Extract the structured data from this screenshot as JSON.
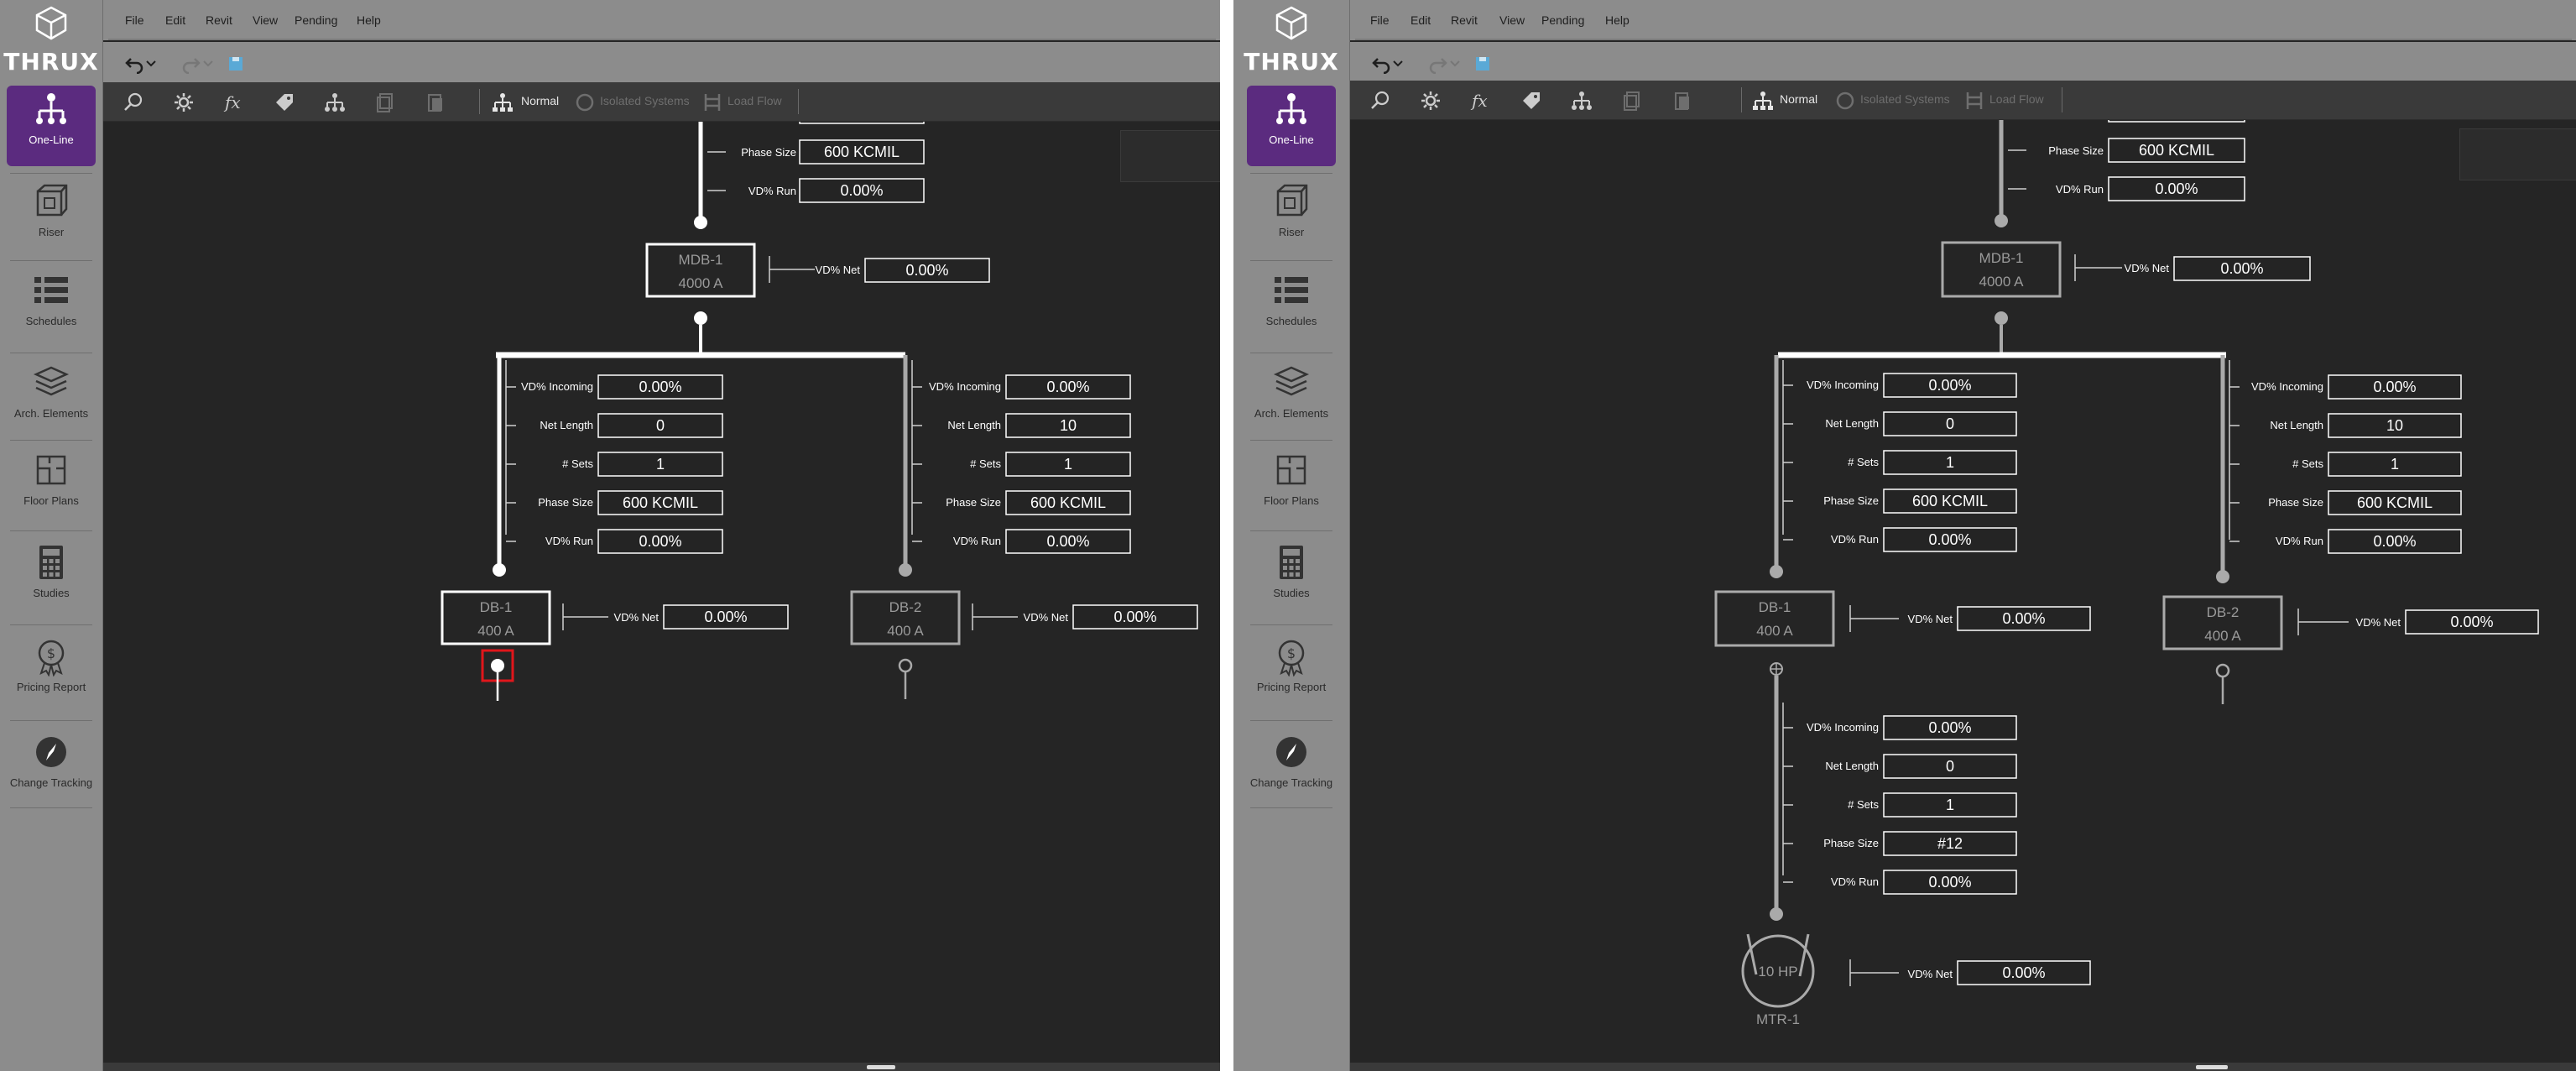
{
  "app": {
    "logo_text": "THRUX"
  },
  "sidebar": {
    "items": [
      {
        "label": "One-Line",
        "icon": "one-line-icon",
        "active": true
      },
      {
        "label": "Riser",
        "icon": "riser-cube-icon"
      },
      {
        "label": "Schedules",
        "icon": "schedules-list-icon"
      },
      {
        "label": "Arch. Elements",
        "icon": "arch-layers-icon"
      },
      {
        "label": "Floor Plans",
        "icon": "floor-plan-icon"
      },
      {
        "label": "Studies",
        "icon": "calculator-icon"
      },
      {
        "label": "Pricing Report",
        "icon": "pricing-badge-icon"
      },
      {
        "label": "Change Tracking",
        "icon": "compass-icon"
      }
    ]
  },
  "menu": [
    "File",
    "Edit",
    "Revit",
    "View",
    "Pending",
    "Help"
  ],
  "quick_access": [
    "undo-icon",
    "undo-dropdown-icon",
    "redo-icon",
    "redo-dropdown-icon",
    "save-icon"
  ],
  "toolbar": {
    "icons": [
      "search-icon",
      "gear-icon",
      "function-fx-icon",
      "tag-icon",
      "hierarchy-icon",
      "copy-icon",
      "paste-icon"
    ],
    "mode_normal": "Normal",
    "mode_isolated": "Isolated Systems",
    "mode_loadflow": "Load Flow"
  },
  "labels": {
    "vd_incoming": "VD% Incoming",
    "net_length": "Net Length",
    "sets": "# Sets",
    "phase_size": "Phase Size",
    "vd_run": "VD% Run",
    "vd_net": "VD% Net"
  },
  "before": {
    "top_feeder": {
      "phase_size": "600 KCMIL",
      "vd_run": "0.00%"
    },
    "mdb": {
      "name": "MDB-1",
      "rating": "4000 A",
      "vd_net": "0.00%"
    },
    "feeder_db1": {
      "vd_incoming": "0.00%",
      "net_length": "0",
      "sets": "1",
      "phase_size": "600 KCMIL",
      "vd_run": "0.00%"
    },
    "feeder_db2": {
      "vd_incoming": "0.00%",
      "net_length": "10",
      "sets": "1",
      "phase_size": "600 KCMIL",
      "vd_run": "0.00%"
    },
    "db1": {
      "name": "DB-1",
      "rating": "400 A",
      "vd_net": "0.00%"
    },
    "db2": {
      "name": "DB-2",
      "rating": "400 A",
      "vd_net": "0.00%"
    }
  },
  "after": {
    "top_feeder": {
      "phase_size": "600 KCMIL",
      "vd_run": "0.00%"
    },
    "mdb": {
      "name": "MDB-1",
      "rating": "4000 A",
      "vd_net": "0.00%"
    },
    "feeder_db1": {
      "vd_incoming": "0.00%",
      "net_length": "0",
      "sets": "1",
      "phase_size": "600 KCMIL",
      "vd_run": "0.00%"
    },
    "feeder_db2": {
      "vd_incoming": "0.00%",
      "net_length": "10",
      "sets": "1",
      "phase_size": "600 KCMIL",
      "vd_run": "0.00%"
    },
    "db1": {
      "name": "DB-1",
      "rating": "400 A",
      "vd_net": "0.00%"
    },
    "db2": {
      "name": "DB-2",
      "rating": "400 A",
      "vd_net": "0.00%"
    },
    "feeder_mtr": {
      "vd_incoming": "0.00%",
      "net_length": "0",
      "sets": "1",
      "phase_size": "#12",
      "vd_run": "0.00%"
    },
    "motor": {
      "size": "10 HP",
      "name": "MTR-1",
      "vd_net": "0.00%"
    }
  },
  "colors": {
    "accent": "#5b2b7f",
    "highlight": "#e0161b",
    "canvas": "#252525",
    "chrome": "#8c8c8c"
  }
}
